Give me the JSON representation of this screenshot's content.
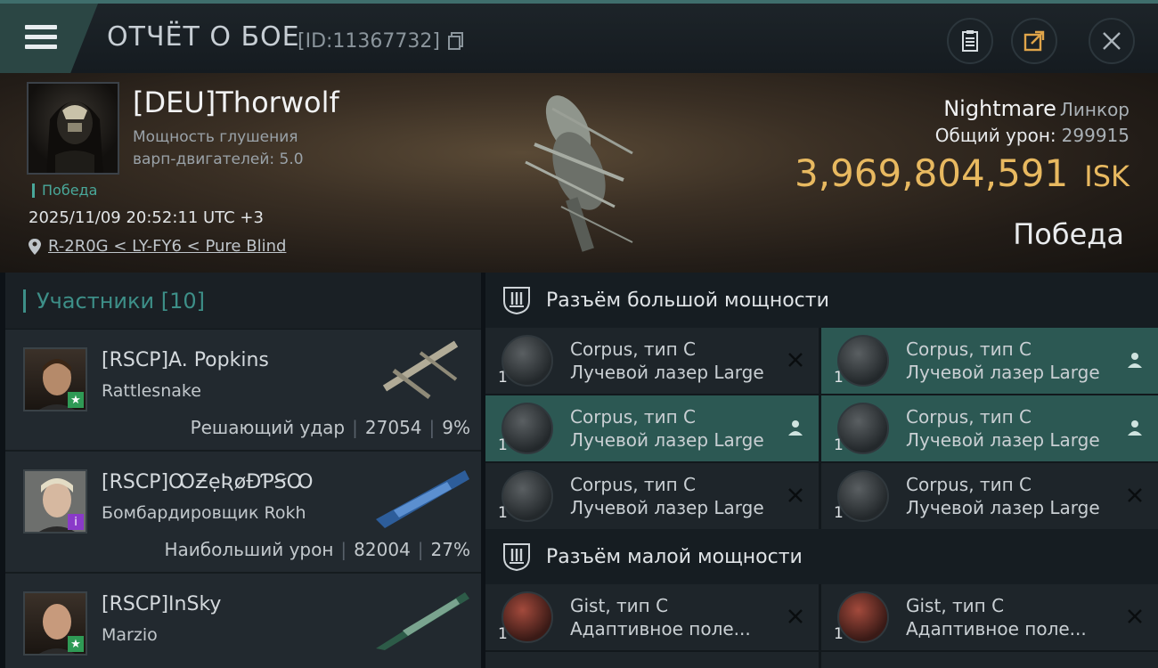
{
  "header": {
    "title": "ОТЧЁТ О БОЕ",
    "report_id": "[ID:11367732]"
  },
  "victim": {
    "name": "[DEU]Thorwolf",
    "attribute_line1": "Мощность глушения",
    "attribute_line2": "варп-двигателей: 5.0",
    "result_tag": "Победа",
    "datetime": "2025/11/09 20:52:11 UTC +3",
    "location": "R-2R0G < LY-FY6 < Pure Blind",
    "ship_name": "Nightmare",
    "ship_class": "Линкор",
    "total_damage_label": "Общий урон:",
    "total_damage": "299915",
    "isk_value": "3,969,804,591",
    "isk_currency": "ISK",
    "outcome": "Победа"
  },
  "participants": {
    "title": "Участники [10]",
    "items": [
      {
        "name": "[RSCP]A. Popkins",
        "ship": "Rattlesnake",
        "role": "Решающий удар",
        "damage": "27054",
        "percent": "9%",
        "badge": "★",
        "badge_color": "#2f9a55"
      },
      {
        "name": "[RSCP]ꝎƵẹƦøƉƤꞨꝎ",
        "ship": "Бомбардировщик Rokh",
        "role": "Наибольший урон",
        "damage": "82004",
        "percent": "27%",
        "badge": "i",
        "badge_color": "#8a3ac9"
      },
      {
        "name": "[RSCP]InSky",
        "ship": "Marzio",
        "role": "",
        "damage": "",
        "percent": "",
        "badge": "★",
        "badge_color": "#2f9a55"
      }
    ]
  },
  "high_slots": {
    "title": "Разъём большой мощности",
    "modules": [
      {
        "qty": "1",
        "name": "Corpus, тип C",
        "type": "Лучевой лазер Large",
        "state": "destroyed"
      },
      {
        "qty": "1",
        "name": "Corpus, тип C",
        "type": "Лучевой лазер Large",
        "state": "dropped"
      },
      {
        "qty": "1",
        "name": "Corpus, тип C",
        "type": "Лучевой лазер Large",
        "state": "dropped"
      },
      {
        "qty": "1",
        "name": "Corpus, тип C",
        "type": "Лучевой лазер Large",
        "state": "dropped"
      },
      {
        "qty": "1",
        "name": "Corpus, тип C",
        "type": "Лучевой лазер Large",
        "state": "destroyed"
      },
      {
        "qty": "1",
        "name": "Corpus, тип C",
        "type": "Лучевой лазер Large",
        "state": "destroyed"
      }
    ]
  },
  "low_slots": {
    "title": "Разъём малой мощности",
    "modules": [
      {
        "qty": "1",
        "name": "Gist, тип C",
        "type": "Адаптивное поле...",
        "state": "destroyed"
      },
      {
        "qty": "1",
        "name": "Gist, тип C",
        "type": "Адаптивное поле...",
        "state": "destroyed"
      }
    ]
  },
  "colors": {
    "accent": "#3d8f88",
    "isk": "#e8b960",
    "highlight": "#2c5853"
  }
}
